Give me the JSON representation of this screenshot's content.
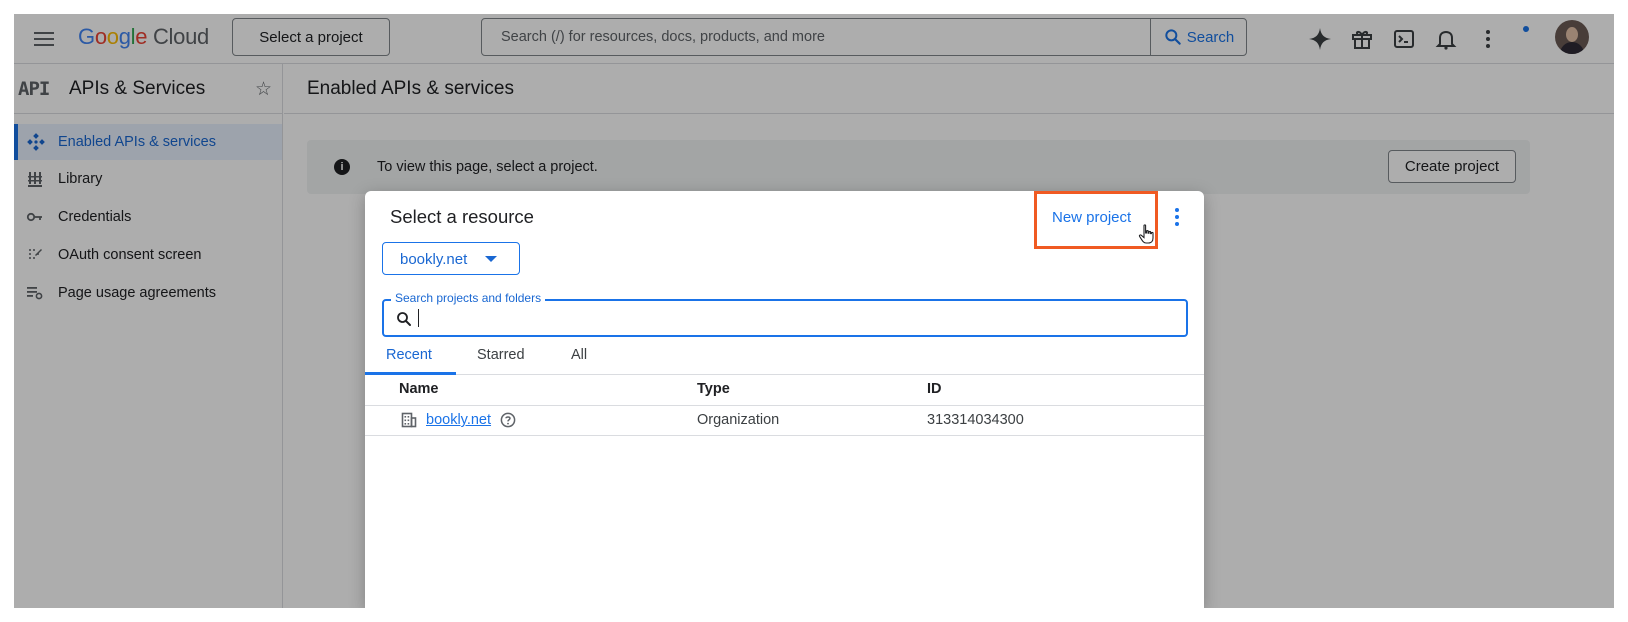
{
  "header": {
    "logo_parts": [
      "G",
      "o",
      "o",
      "g",
      "l",
      "e"
    ],
    "logo_cloud": "Cloud",
    "project_picker_label": "Select a project",
    "search_placeholder": "Search (/) for resources, docs, products, and more",
    "search_button_label": "Search"
  },
  "sidebar": {
    "badge": "API",
    "title": "APIs & Services",
    "items": [
      {
        "label": "Enabled APIs & services",
        "icon": "diamond-grid-icon",
        "active": true
      },
      {
        "label": "Library",
        "icon": "library-icon",
        "active": false
      },
      {
        "label": "Credentials",
        "icon": "key-icon",
        "active": false
      },
      {
        "label": "OAuth consent screen",
        "icon": "oauth-icon",
        "active": false
      },
      {
        "label": "Page usage agreements",
        "icon": "settings-list-icon",
        "active": false
      }
    ]
  },
  "main": {
    "title": "Enabled APIs & services",
    "banner_message": "To view this page, select a project.",
    "create_project_label": "Create project"
  },
  "dialog": {
    "title": "Select a resource",
    "new_project_label": "New project",
    "org_selector_value": "bookly.net",
    "search_label": "Search projects and folders",
    "tabs": [
      "Recent",
      "Starred",
      "All"
    ],
    "columns": [
      "Name",
      "Type",
      "ID"
    ],
    "rows": [
      {
        "name": "bookly.net",
        "type": "Organization",
        "id": "313314034300"
      }
    ]
  },
  "colors": {
    "accent": "#1a73e8",
    "highlight_box": "#f05a22",
    "scrim": "rgba(0,0,0,0.32)"
  }
}
